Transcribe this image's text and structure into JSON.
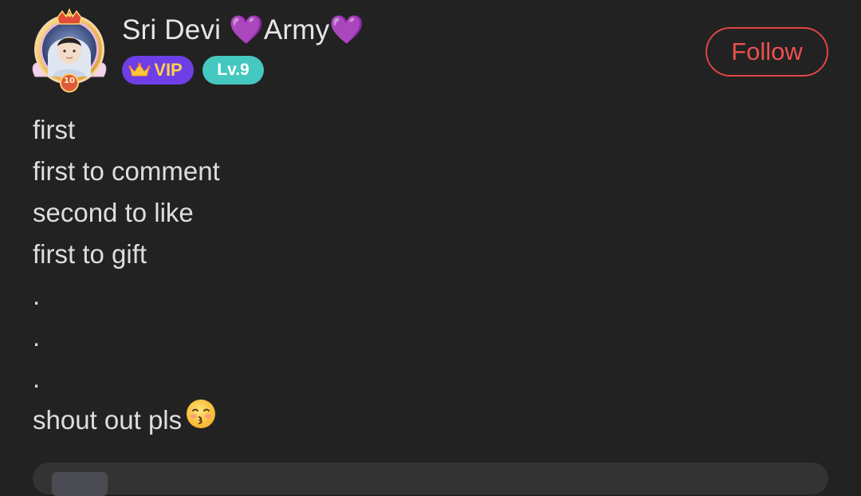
{
  "author": {
    "name": "Sri Devi 💜Army💜",
    "avatar_icon": "avatar-icon",
    "avatar_frame_level": "10",
    "badges": {
      "vip_label": "VIP",
      "level_label": "Lv.9"
    }
  },
  "follow_button": {
    "label": "Follow"
  },
  "post": {
    "lines": [
      "first",
      "first to comment",
      "second to like",
      "first to gift",
      ".",
      ".",
      ".",
      "shout out pls"
    ],
    "emoji_icon": "kissing-face-icon"
  },
  "colors": {
    "background": "#222222",
    "follow_accent": "#e04545",
    "vip_badge": "#6e3fe6",
    "vip_text": "#ffd24a",
    "level_badge": "#45c8c0"
  }
}
